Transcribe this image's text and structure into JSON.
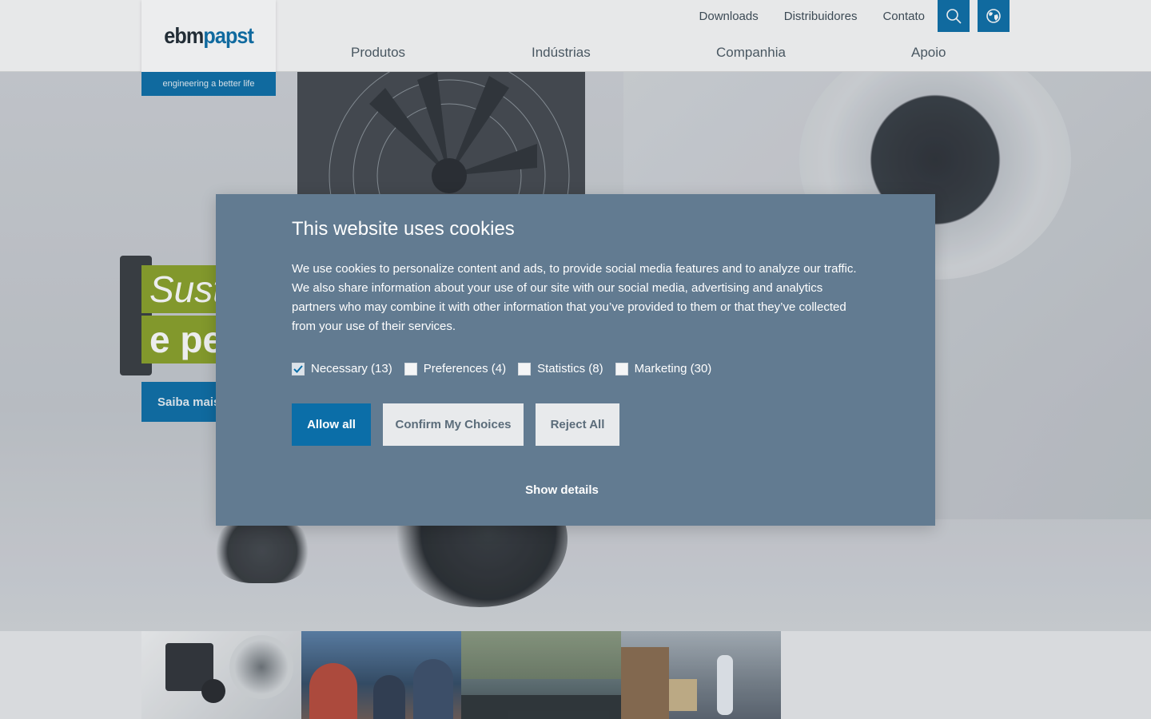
{
  "header": {
    "logo": {
      "part1": "ebm",
      "part2": "papst"
    },
    "tagline": "engineering a better life",
    "utility_links": [
      "Downloads",
      "Distribuidores",
      "Contato"
    ],
    "icons": {
      "search": "search-icon",
      "language": "globe-icon"
    },
    "main_nav": [
      "Produtos",
      "Indústrias",
      "Companhia",
      "Apoio"
    ]
  },
  "hero": {
    "slogan_line1": "Sust",
    "slogan_line2": "e pe",
    "button_label": "Saiba mais"
  },
  "cookie_dialog": {
    "title": "This website uses cookies",
    "body": "We use cookies to personalize content and ads, to provide social media features and to analyze our traffic. We also share information about your use of our site with our social media, advertising and analytics partners who may combine it with other information that you’ve provided to them or that they’ve collected from your use of their services.",
    "consents": [
      {
        "label": "Necessary (13)",
        "checked": true
      },
      {
        "label": "Preferences (4)",
        "checked": false
      },
      {
        "label": "Statistics (8)",
        "checked": false
      },
      {
        "label": "Marketing (30)",
        "checked": false
      }
    ],
    "buttons": {
      "allow_all": "Allow all",
      "confirm": "Confirm My Choices",
      "reject": "Reject All"
    },
    "show_details": "Show details"
  },
  "colors": {
    "brand_blue": "#0b6ea8",
    "dialog_bg": "#627b91",
    "slogan_green": "#8aa128"
  }
}
